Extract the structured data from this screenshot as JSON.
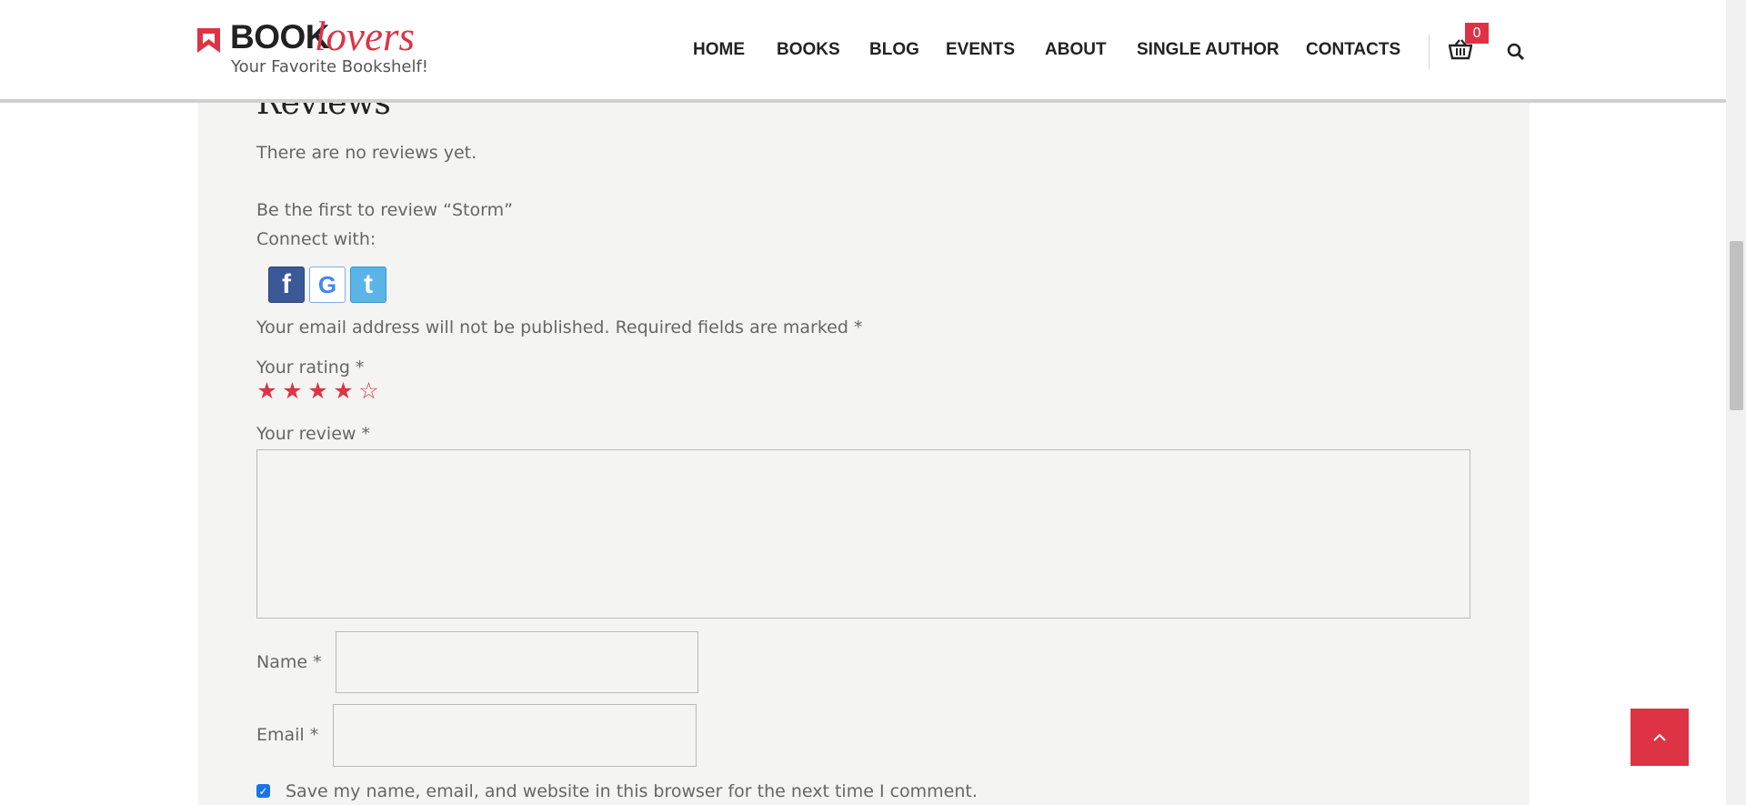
{
  "header": {
    "logo_book": "BOOK",
    "logo_lovers": "lovers",
    "tagline": "Your Favorite Bookshelf!",
    "nav": [
      "HOME",
      "BOOKS",
      "BLOG",
      "EVENTS",
      "ABOUT",
      "SINGLE AUTHOR",
      "CONTACTS"
    ],
    "cart_count": "0",
    "accent_color": "#dd3345"
  },
  "reviews": {
    "heading": "Reviews",
    "no_reviews": "There are no reviews yet.",
    "first_review": "Be the first to review “Storm”",
    "connect_with": "Connect with:",
    "social": [
      "facebook-icon",
      "google-icon",
      "twitter-icon"
    ],
    "email_note": "Your email address will not be published. Required fields are marked *",
    "rating_label": "Your rating *",
    "rating_value": 4,
    "rating_max": 5,
    "review_label": "Your review *",
    "review_value": "",
    "name_label": "Name *",
    "name_value": "",
    "email_label": "Email *",
    "email_value": "",
    "save_checked": true,
    "save_label": "Save my name, email, and website in this browser for the next time I comment."
  }
}
